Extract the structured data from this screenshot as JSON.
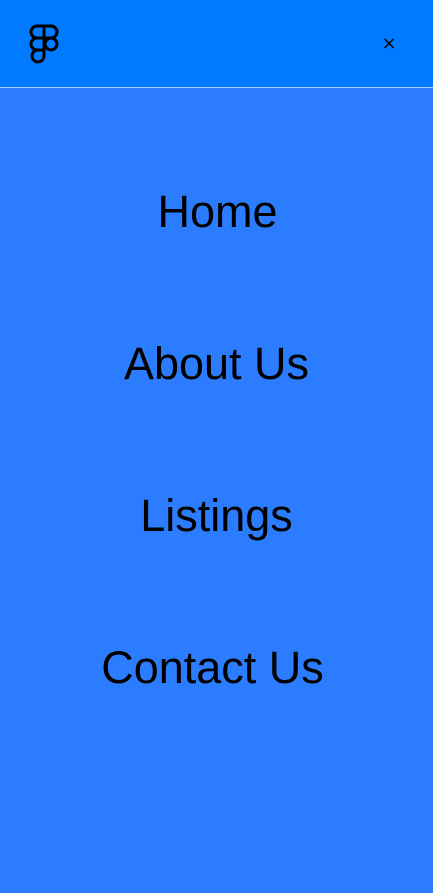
{
  "header": {
    "logo_icon": "figma-logo-icon",
    "close_icon": "close-icon",
    "close_symbol": "×"
  },
  "menu": {
    "items": [
      {
        "label": "Home"
      },
      {
        "label": "About Us"
      },
      {
        "label": "Listings"
      },
      {
        "label": "Contact Us"
      }
    ]
  },
  "colors": {
    "header_bg": "#007bff",
    "menu_bg": "#2b7cff",
    "text": "#000000"
  }
}
